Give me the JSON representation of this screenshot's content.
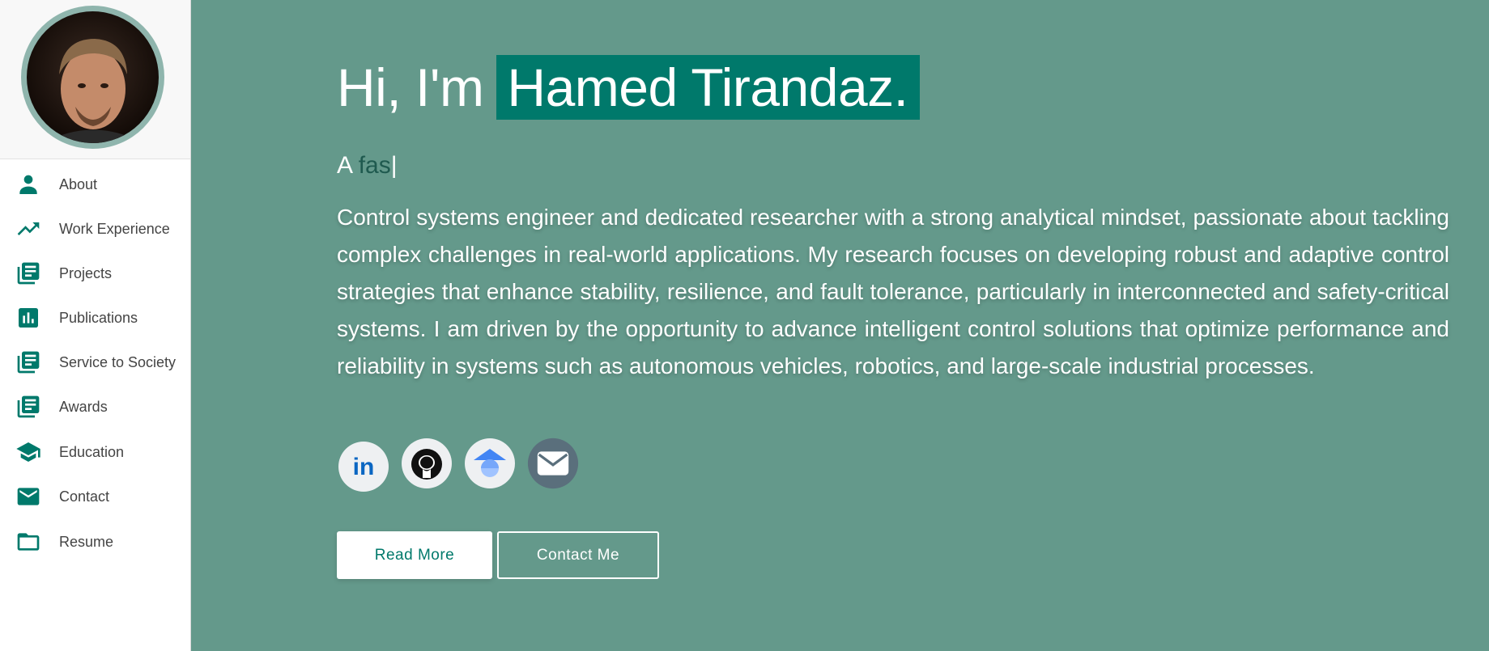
{
  "sidebar": {
    "avatar_alt": "Profile photo",
    "items": [
      {
        "label": "About",
        "icon": "person-icon"
      },
      {
        "label": "Work Experience",
        "icon": "trending-up-icon"
      },
      {
        "label": "Projects",
        "icon": "library-books-icon"
      },
      {
        "label": "Publications",
        "icon": "bar-chart-icon"
      },
      {
        "label": "Service to Society",
        "icon": "library-books-icon"
      },
      {
        "label": "Awards",
        "icon": "library-books-icon"
      },
      {
        "label": "Education",
        "icon": "school-icon"
      },
      {
        "label": "Contact",
        "icon": "mail-icon"
      },
      {
        "label": "Resume",
        "icon": "folder-icon"
      }
    ]
  },
  "hero": {
    "greeting": "Hi, I'm",
    "name": "Hamed Tirandaz.",
    "typed_prefix": "A",
    "typed_text": "fas",
    "typed_cursor": "|",
    "bio": "Control systems engineer and dedicated researcher with a strong analytical mindset, passionate about tackling complex challenges in real-world applications. My research focuses on developing robust and adaptive control strategies that enhance stability, resilience, and fault tolerance, particularly in interconnected and safety-critical systems. I am driven by the opportunity to advance intelligent control solutions that optimize performance and reliability in systems such as autonomous vehicles, robotics, and large-scale industrial processes.",
    "socials": [
      {
        "icon": "linkedin-icon",
        "label": "in"
      },
      {
        "icon": "github-icon"
      },
      {
        "icon": "google-scholar-icon"
      },
      {
        "icon": "email-icon"
      }
    ],
    "read_more_label": "Read More",
    "contact_label": "Contact Me"
  },
  "colors": {
    "accent": "#00796b",
    "hero_background": "#64998b",
    "sidebar_background": "#ffffff",
    "typed_text": "#1f5a4f"
  }
}
